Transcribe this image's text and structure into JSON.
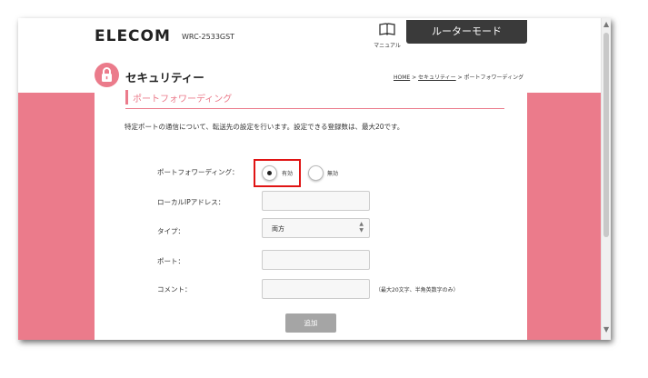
{
  "header": {
    "logo": "ELECOM",
    "model": "WRC-2533GST",
    "manual_label": "マニュアル",
    "mode_button": "ルーターモード"
  },
  "page": {
    "title": "セキュリティー",
    "breadcrumb": [
      "HOME",
      "セキュリティー",
      "ポートフォワーディング"
    ],
    "breadcrumb_sep": " > "
  },
  "section": {
    "title": "ポートフォワーディング",
    "description": "特定ポートの通信について、転送先の設定を行います。設定できる登録数は、最大20です。"
  },
  "form": {
    "port_forwarding": {
      "label": "ポートフォワーディング：",
      "options": [
        "有効",
        "無効"
      ],
      "selected": "有効"
    },
    "local_ip": {
      "label": "ローカルIPアドレス：",
      "value": ""
    },
    "type": {
      "label": "タイプ：",
      "selected": "両方"
    },
    "port": {
      "label": "ポート：",
      "value": ""
    },
    "comment": {
      "label": "コメント：",
      "value": "",
      "hint": "（最大20文字、半角英数字のみ）"
    },
    "add_button": "追加"
  },
  "colors": {
    "accent": "#eb7b8b",
    "highlight": "#e01414",
    "mode_button_bg": "#3a3a3a"
  },
  "icons": {
    "manual": "book-icon",
    "lock": "lock-icon"
  }
}
